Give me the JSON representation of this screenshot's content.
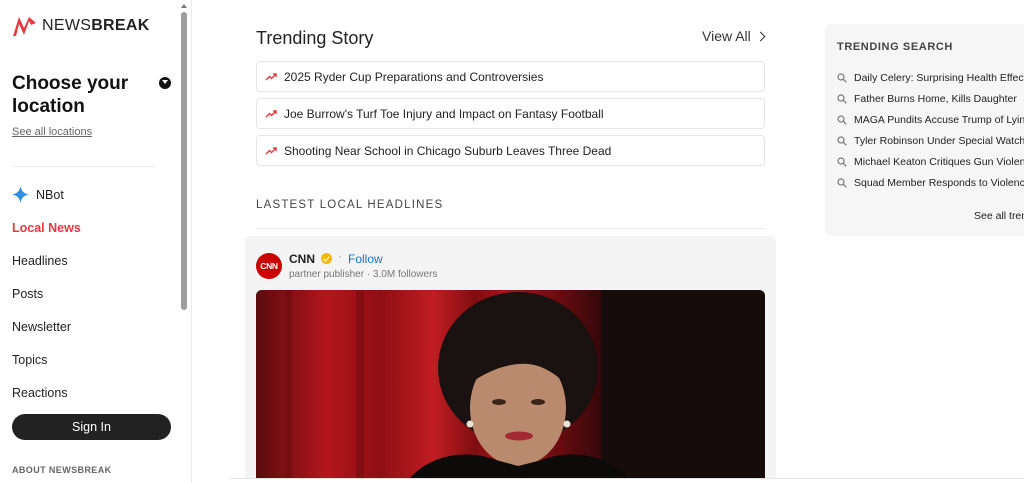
{
  "brand": {
    "logo_text_a": "NEWS",
    "logo_text_b": "BREAK"
  },
  "sidebar": {
    "location_title": "Choose your location",
    "see_all_locations": "See all locations",
    "items": [
      {
        "label": "NBot",
        "icon": "sparkle-icon"
      },
      {
        "label": "Local News",
        "active": true
      },
      {
        "label": "Headlines"
      },
      {
        "label": "Posts"
      },
      {
        "label": "Newsletter"
      },
      {
        "label": "Topics"
      },
      {
        "label": "Reactions"
      }
    ],
    "sign_in": "Sign In",
    "about": "ABOUT NEWSBREAK"
  },
  "trending": {
    "title": "Trending Story",
    "view_all": "View All",
    "stories": [
      "2025 Ryder Cup Preparations and Controversies",
      "Joe Burrow's Turf Toe Injury and Impact on Fantasy Football",
      "Shooting Near School in Chicago Suburb Leaves Three Dead"
    ]
  },
  "local": {
    "heading": "LASTEST LOCAL HEADLINES",
    "card": {
      "publisher": "CNN",
      "logo_text": "CNN",
      "dot": "·",
      "follow": "Follow",
      "meta": "partner publisher · 3.0M followers"
    }
  },
  "trending_search": {
    "title": "TRENDING SEARCH",
    "items": [
      "Daily Celery: Surprising Health Effects",
      "Father Burns Home, Kills Daughter",
      "MAGA Pundits Accuse Trump of Lying",
      "Tyler Robinson Under Special Watch",
      "Michael Keaton Critiques Gun Violence",
      "Squad Member Responds to Violence"
    ],
    "see_all": "See all trending"
  },
  "colors": {
    "accent": "#e9383f",
    "link": "#1a73c8",
    "verified": "#f5b800",
    "cnn": "#cc0000"
  }
}
